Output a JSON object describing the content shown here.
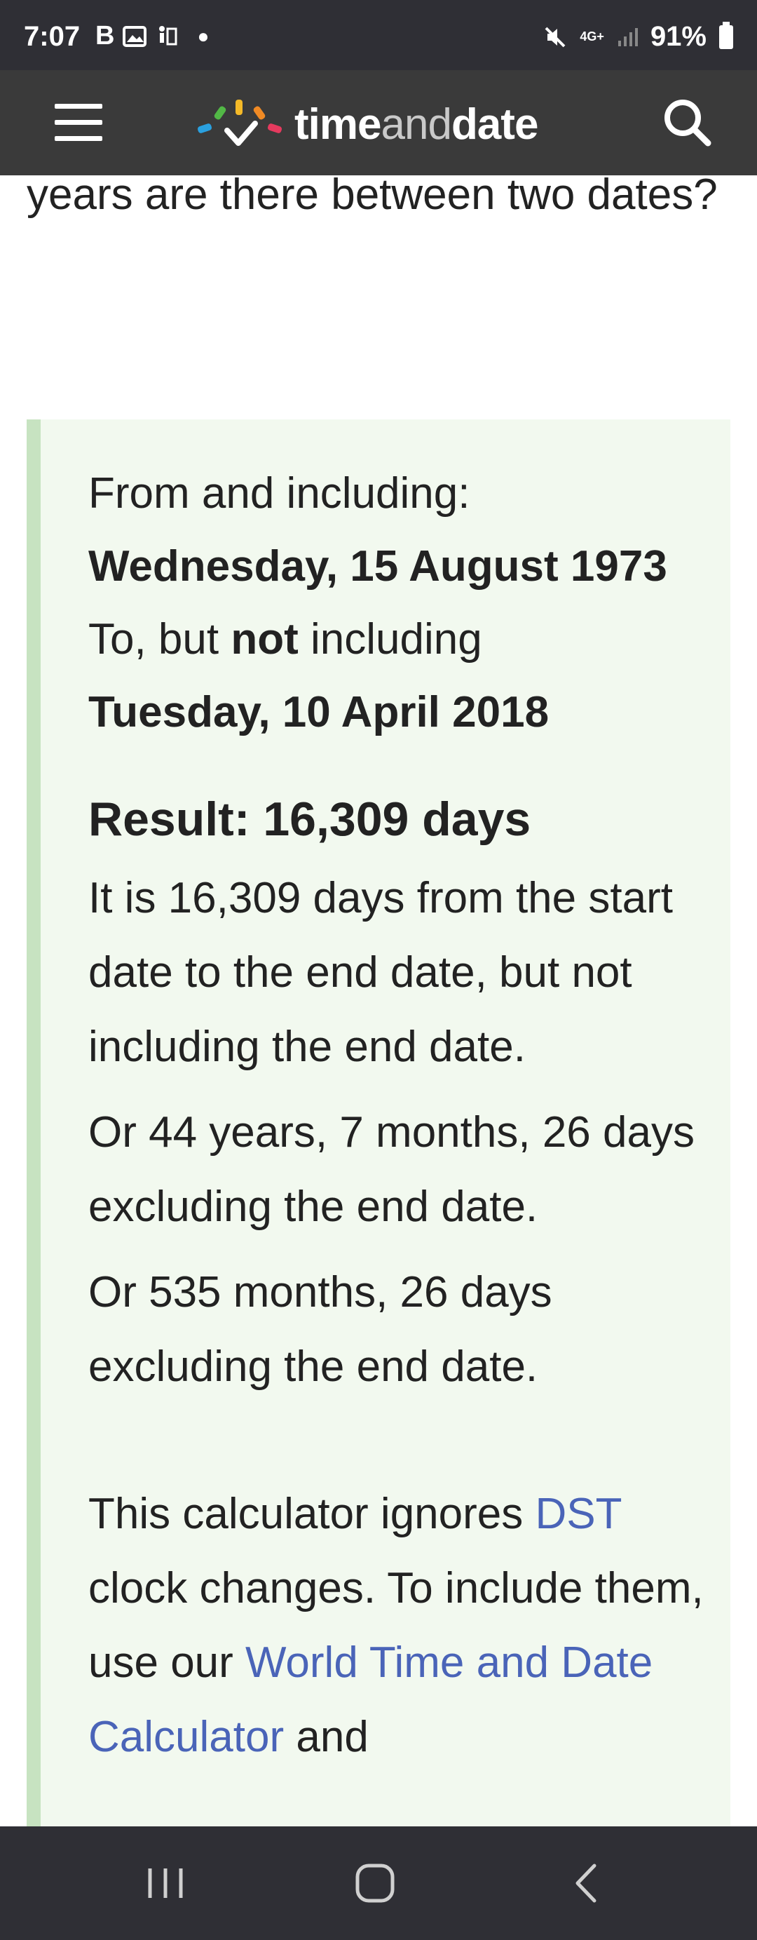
{
  "status_bar": {
    "time": "7:07",
    "left_icons": [
      "B",
      "gallery-icon",
      "accessibility-icon"
    ],
    "network": "4G+",
    "battery": "91%"
  },
  "header": {
    "brand_part1": "time",
    "brand_part2": "and",
    "brand_part3": "date"
  },
  "intro_text": "years are there between two dates?",
  "result": {
    "from_label": "From and including:",
    "from_date": "Wednesday, 15 August 1973",
    "to_label_pre": "To, but ",
    "to_label_bold": "not",
    "to_label_post": " including",
    "to_date": "Tuesday, 10 April 2018",
    "title": "Result: 16,309 days",
    "para1": "It is 16,309 days from the start date to the end date, but not including the end date.",
    "para2": "Or 44 years, 7 months, 26 days excluding the end date.",
    "para3": "Or 535 months, 26 days excluding the end date.",
    "note_pre": "This calculator ignores ",
    "note_link1": "DST",
    "note_mid": " clock changes. To include them, use our ",
    "note_link2": "World Time and Date Calculator",
    "note_post": " and"
  },
  "colors": {
    "header_bg": "#3a3a3a",
    "result_bg": "#f2f9ef",
    "result_border": "#c7e3c1",
    "link": "#4a64b8"
  }
}
